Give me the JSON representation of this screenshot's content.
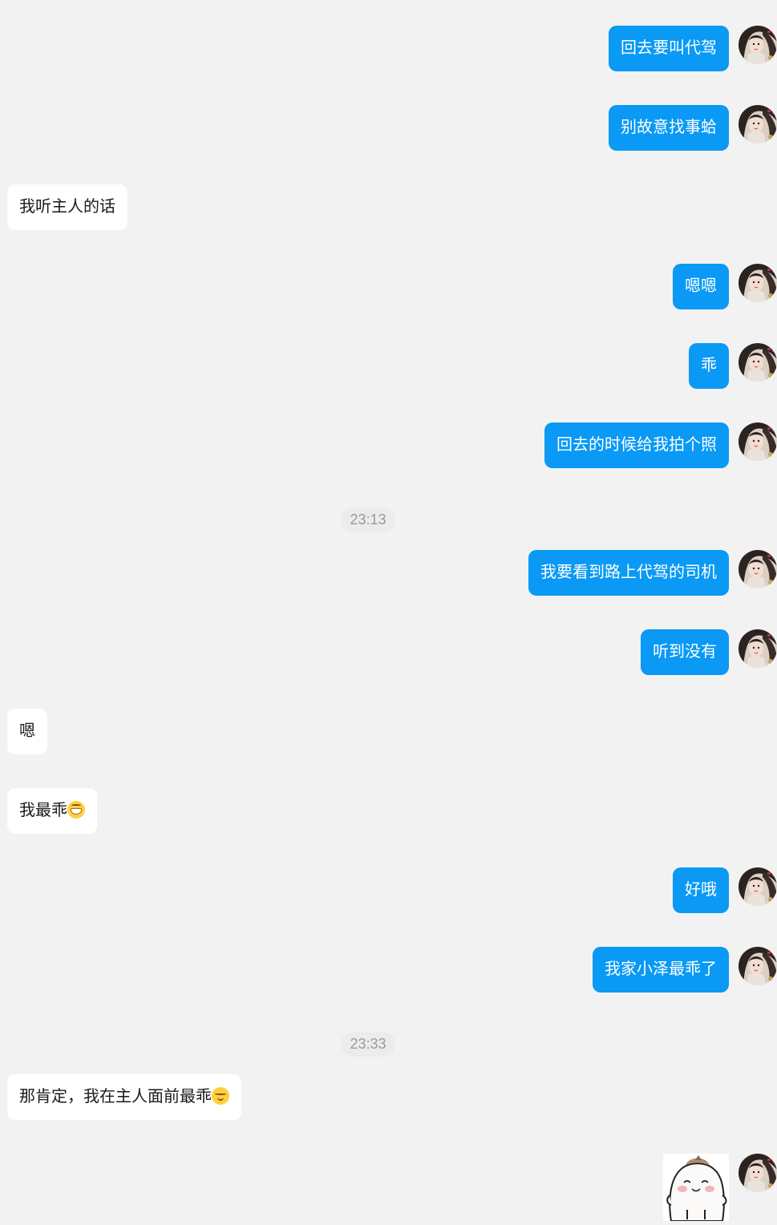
{
  "messages": [
    {
      "side": "out",
      "text": "回去要叫代驾"
    },
    {
      "side": "out",
      "text": "别故意找事蛤"
    },
    {
      "side": "in",
      "text": "我听主人的话"
    },
    {
      "side": "out",
      "text": "嗯嗯"
    },
    {
      "side": "out",
      "text": "乖"
    },
    {
      "side": "out",
      "text": "回去的时候给我拍个照"
    },
    {
      "side": "time",
      "text": "23:13"
    },
    {
      "side": "out",
      "text": "我要看到路上代驾的司机"
    },
    {
      "side": "out",
      "text": "听到没有"
    },
    {
      "side": "in",
      "text": "嗯"
    },
    {
      "side": "in",
      "text": "我最乖",
      "emoji": "grin-face-icon"
    },
    {
      "side": "out",
      "text": "好哦"
    },
    {
      "side": "out",
      "text": "我家小泽最乖了"
    },
    {
      "side": "time",
      "text": "23:33"
    },
    {
      "side": "in",
      "text": "那肯定，我在主人面前最乖",
      "emoji": "smug-face-icon"
    },
    {
      "side": "out",
      "sticker": "hamster-sticker"
    }
  ],
  "colors": {
    "background": "#f2f2f2",
    "outgoing_bubble": "#0a99f5",
    "incoming_bubble": "#ffffff",
    "time_text": "#9a9a9a"
  }
}
